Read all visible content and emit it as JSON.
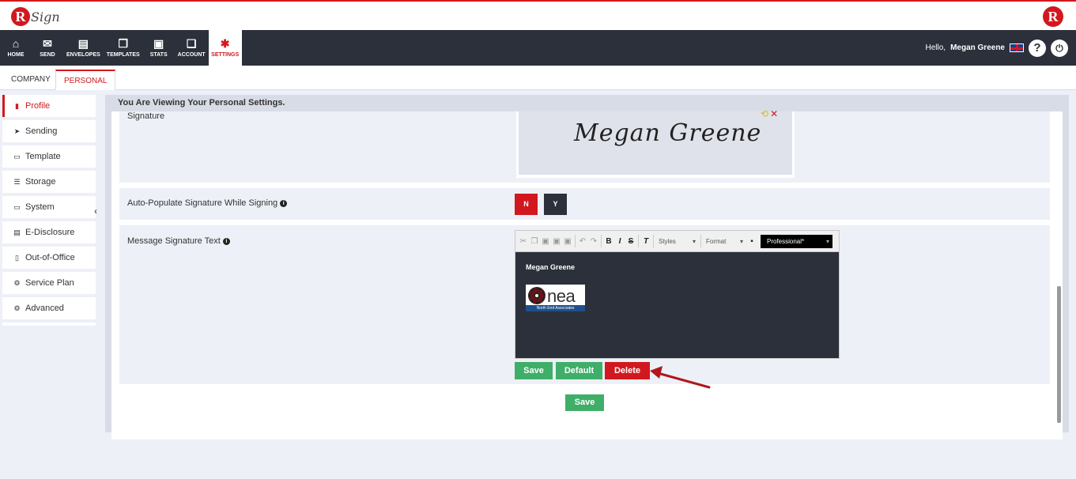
{
  "header": {
    "logo_letter": "R",
    "logo_text": "Sign",
    "brand_letter": "R"
  },
  "nav": {
    "items": [
      {
        "label": "HOME",
        "icon": "home-icon"
      },
      {
        "label": "SEND",
        "icon": "envelope-icon"
      },
      {
        "label": "ENVELOPES",
        "icon": "envelopes-icon"
      },
      {
        "label": "TEMPLATES",
        "icon": "templates-icon"
      },
      {
        "label": "STATS",
        "icon": "briefcase-icon"
      },
      {
        "label": "ACCOUNT",
        "icon": "account-icon"
      },
      {
        "label": "SETTINGS",
        "icon": "gear-icon"
      }
    ],
    "hello": "Hello,",
    "user_name": "Megan Greene",
    "help_symbol": "?",
    "power_symbol": "⏻"
  },
  "tabs": [
    "COMPANY",
    "PERSONAL"
  ],
  "sidebar": {
    "items": [
      {
        "label": "Profile",
        "icon": "profile-icon"
      },
      {
        "label": "Sending",
        "icon": "paper-plane-icon"
      },
      {
        "label": "Template",
        "icon": "template-icon"
      },
      {
        "label": "Storage",
        "icon": "storage-icon"
      },
      {
        "label": "System",
        "icon": "monitor-icon"
      },
      {
        "label": "E-Disclosure",
        "icon": "document-icon"
      },
      {
        "label": "Out-of-Office",
        "icon": "phone-icon"
      },
      {
        "label": "Service Plan",
        "icon": "service-plan-icon"
      },
      {
        "label": "Advanced",
        "icon": "cogs-icon"
      }
    ],
    "collapse_symbol": "‹"
  },
  "main": {
    "viewing_text": "You Are Viewing Your Personal Settings.",
    "signature_label": "Signature",
    "signature_value": "Megan Greene",
    "auto_populate_label": "Auto-Populate Signature While Signing",
    "toggle_n": "N",
    "toggle_y": "Y",
    "message_sig_label": "Message Signature Text",
    "editor": {
      "styles_label": "Styles",
      "format_label": "Format",
      "font_label": "Professional*",
      "content_name": "Megan Greene",
      "logo_text": "nea",
      "logo_subtext": "North End Associates"
    },
    "buttons": {
      "save": "Save",
      "default": "Default",
      "delete": "Delete",
      "bottom_save": "Save"
    }
  },
  "colors": {
    "brand_red": "#d2181f",
    "nav_dark": "#2b303a",
    "save_green": "#3fae68",
    "annotation_arrow": "#b0161c"
  }
}
